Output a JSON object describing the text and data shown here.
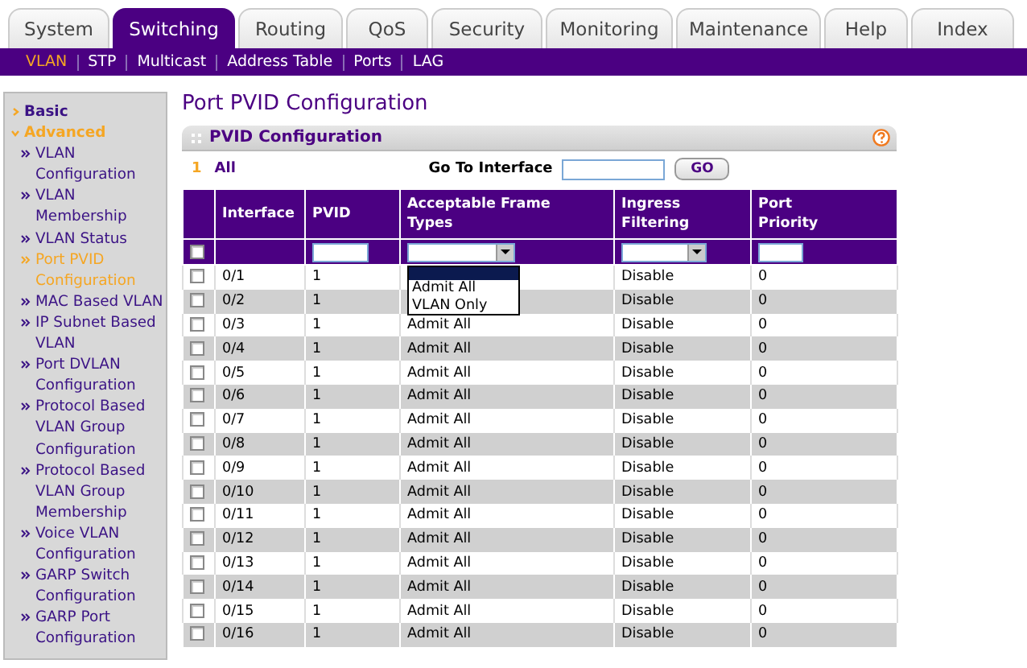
{
  "tabs": [
    {
      "label": "System",
      "selected": false
    },
    {
      "label": "Switching",
      "selected": true
    },
    {
      "label": "Routing",
      "selected": false
    },
    {
      "label": "QoS",
      "selected": false
    },
    {
      "label": "Security",
      "selected": false
    },
    {
      "label": "Monitoring",
      "selected": false
    },
    {
      "label": "Maintenance",
      "selected": false
    },
    {
      "label": "Help",
      "selected": false
    },
    {
      "label": "Index",
      "selected": false
    }
  ],
  "subnav": [
    {
      "label": "VLAN",
      "selected": true
    },
    {
      "label": "STP",
      "selected": false
    },
    {
      "label": "Multicast",
      "selected": false
    },
    {
      "label": "Address Table",
      "selected": false
    },
    {
      "label": "Ports",
      "selected": false
    },
    {
      "label": "LAG",
      "selected": false
    }
  ],
  "sidebar": {
    "items": [
      {
        "label": "Basic",
        "expanded": false
      },
      {
        "label": "Advanced",
        "expanded": true,
        "children": [
          {
            "label": "VLAN Configuration",
            "selected": false
          },
          {
            "label": "VLAN Membership",
            "selected": false
          },
          {
            "label": "VLAN Status",
            "selected": false
          },
          {
            "label": "Port PVID Configuration",
            "selected": true
          },
          {
            "label": "MAC Based VLAN",
            "selected": false
          },
          {
            "label": "IP Subnet Based VLAN",
            "selected": false
          },
          {
            "label": "Port DVLAN Configuration",
            "selected": false
          },
          {
            "label": "Protocol Based VLAN Group Configuration",
            "selected": false
          },
          {
            "label": "Protocol Based VLAN Group Membership",
            "selected": false
          },
          {
            "label": "Voice VLAN Configuration",
            "selected": false
          },
          {
            "label": "GARP Switch Configuration",
            "selected": false
          },
          {
            "label": "GARP Port Configuration",
            "selected": false
          }
        ]
      }
    ]
  },
  "page_title": "Port PVID Configuration",
  "panel": {
    "title": "PVID Configuration",
    "range": {
      "number": "1",
      "label": "All"
    },
    "go_to": {
      "label": "Go To Interface",
      "button": "GO"
    },
    "table": {
      "columns": [
        "Interface",
        "PVID",
        "Acceptable Frame Types",
        "Ingress Filtering",
        "Port Priority"
      ],
      "filter_row": {
        "checked": false
      },
      "frame_type_dropdown": {
        "options": [
          {
            "label": "Admit All",
            "selected": false
          },
          {
            "label": "VLAN Only",
            "selected": false
          }
        ]
      },
      "rows": [
        {
          "checked": false,
          "interface": "0/1",
          "pvid": "1",
          "ingress": "Disable",
          "priority": "0"
        },
        {
          "checked": false,
          "interface": "0/2",
          "pvid": "1",
          "ingress": "Disable",
          "priority": "0"
        },
        {
          "checked": false,
          "interface": "0/3",
          "pvid": "1",
          "frame_types": "Admit All",
          "ingress": "Disable",
          "priority": "0"
        },
        {
          "checked": false,
          "interface": "0/4",
          "pvid": "1",
          "frame_types": "Admit All",
          "ingress": "Disable",
          "priority": "0"
        },
        {
          "checked": false,
          "interface": "0/5",
          "pvid": "1",
          "frame_types": "Admit All",
          "ingress": "Disable",
          "priority": "0"
        },
        {
          "checked": false,
          "interface": "0/6",
          "pvid": "1",
          "frame_types": "Admit All",
          "ingress": "Disable",
          "priority": "0"
        },
        {
          "checked": false,
          "interface": "0/7",
          "pvid": "1",
          "frame_types": "Admit All",
          "ingress": "Disable",
          "priority": "0"
        },
        {
          "checked": false,
          "interface": "0/8",
          "pvid": "1",
          "frame_types": "Admit All",
          "ingress": "Disable",
          "priority": "0"
        },
        {
          "checked": false,
          "interface": "0/9",
          "pvid": "1",
          "frame_types": "Admit All",
          "ingress": "Disable",
          "priority": "0"
        },
        {
          "checked": false,
          "interface": "0/10",
          "pvid": "1",
          "frame_types": "Admit All",
          "ingress": "Disable",
          "priority": "0"
        },
        {
          "checked": false,
          "interface": "0/11",
          "pvid": "1",
          "frame_types": "Admit All",
          "ingress": "Disable",
          "priority": "0"
        },
        {
          "checked": false,
          "interface": "0/12",
          "pvid": "1",
          "frame_types": "Admit All",
          "ingress": "Disable",
          "priority": "0"
        },
        {
          "checked": false,
          "interface": "0/13",
          "pvid": "1",
          "frame_types": "Admit All",
          "ingress": "Disable",
          "priority": "0"
        },
        {
          "checked": false,
          "interface": "0/14",
          "pvid": "1",
          "frame_types": "Admit All",
          "ingress": "Disable",
          "priority": "0"
        },
        {
          "checked": false,
          "interface": "0/15",
          "pvid": "1",
          "frame_types": "Admit All",
          "ingress": "Disable",
          "priority": "0"
        },
        {
          "checked": false,
          "interface": "0/16",
          "pvid": "1",
          "frame_types": "Admit All",
          "ingress": "Disable",
          "priority": "0"
        }
      ]
    }
  }
}
